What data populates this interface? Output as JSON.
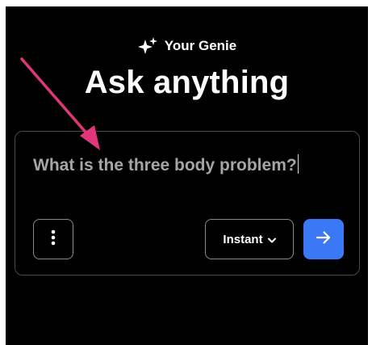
{
  "brand": {
    "icon": "sparkles-icon",
    "name": "Your Genie"
  },
  "headline": "Ask anything",
  "prompt": {
    "value": "What is the three body problem?",
    "placeholder": ""
  },
  "controls": {
    "more_icon": "vertical-dots-icon",
    "mode_label": "Instant",
    "mode_icon": "chevron-down-icon",
    "send_icon": "arrow-right-icon"
  },
  "colors": {
    "background": "#000000",
    "send_button": "#3b78f5",
    "annotation_arrow": "#e1367a",
    "input_text": "#a5a5a5"
  }
}
